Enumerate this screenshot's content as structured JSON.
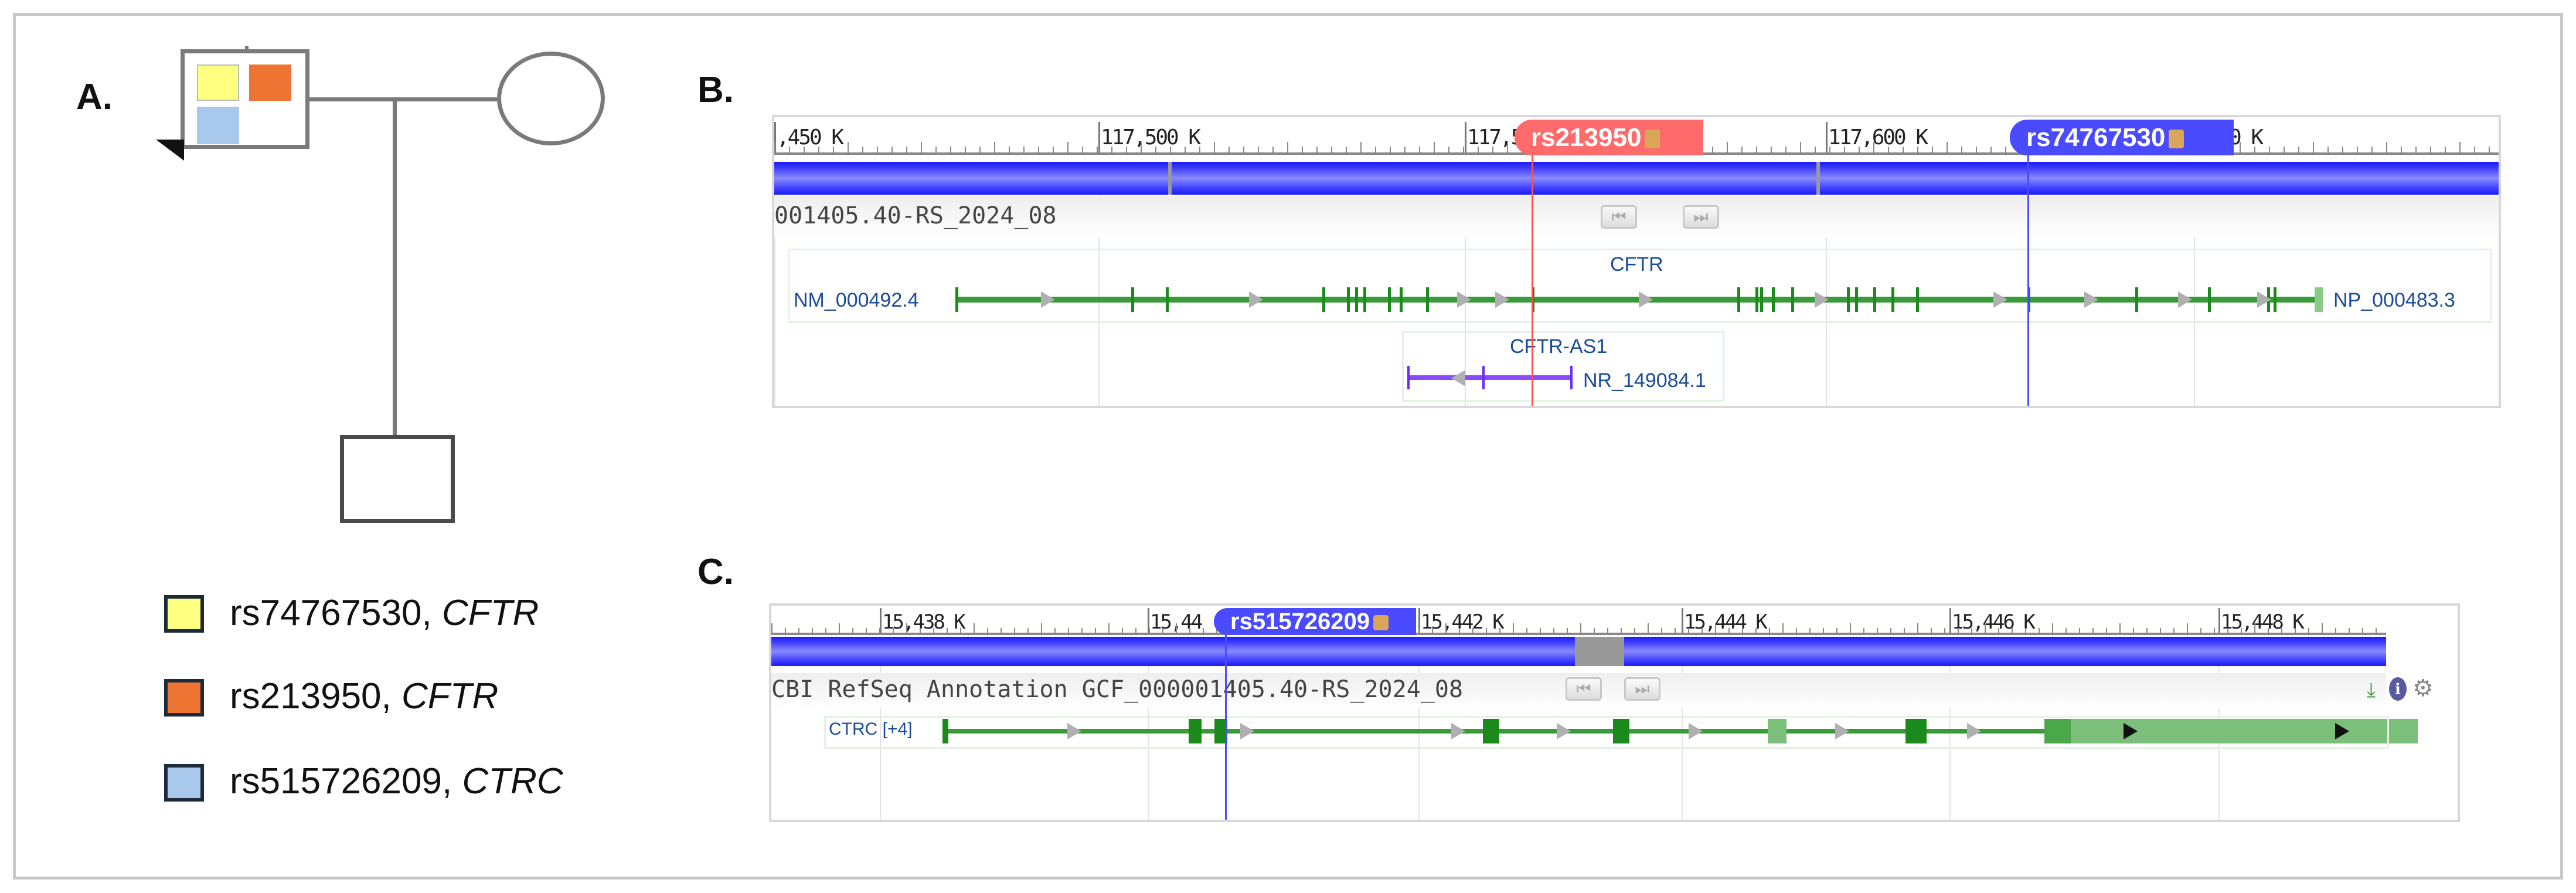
{
  "panels": {
    "a": "A.",
    "b": "B.",
    "c": "C."
  },
  "legend": [
    {
      "variant": "rs74767530",
      "gene": "CFTR",
      "color": "#ffff80"
    },
    {
      "variant": "rs213950",
      "gene": "CFTR",
      "color": "#ed7433"
    },
    {
      "variant": "rs515726209",
      "gene": "CTRC",
      "color": "#a8c8ec"
    }
  ],
  "panel_b": {
    "ruler_labels": [
      ",450 K",
      "117,500 K",
      "117,5",
      "117,600 K",
      ",650 K"
    ],
    "track_title": "001405.40-RS_2024_08",
    "markers": [
      {
        "label": "rs213950",
        "color": "#ff6a6a"
      },
      {
        "label": "rs74767530",
        "color": "#4a4aff"
      }
    ],
    "gene": {
      "name": "CFTR",
      "transcript": "NM_000492.4",
      "protein": "NP_000483.3"
    },
    "gene2": {
      "name": "CFTR-AS1",
      "transcript": "NR_149084.1"
    }
  },
  "panel_c": {
    "ruler_labels": [
      "15,438 K",
      "15,44",
      "15,442 K",
      "15,444 K",
      "15,446 K",
      "15,448 K"
    ],
    "track_title": "CBI RefSeq Annotation GCF_000001405.40-RS_2024_08",
    "marker": {
      "label": "rs515726209",
      "color": "#4a4aff"
    },
    "gene": {
      "label": "CTRC [+4]"
    }
  },
  "icons": {
    "prev": "⏮",
    "next": "⏭",
    "download": "⤓",
    "info": "ℹ",
    "settings": "⚙"
  }
}
